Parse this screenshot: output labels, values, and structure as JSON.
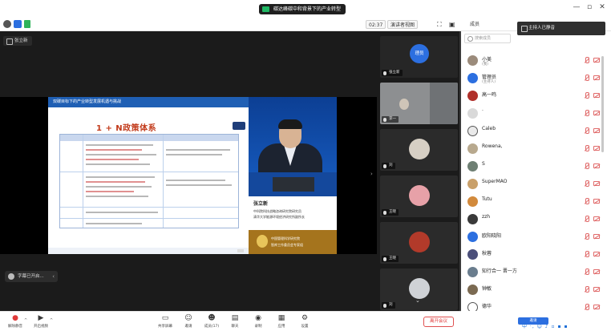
{
  "titlebar": {
    "meeting_title": "碳达峰碳中和背景下的产业转型",
    "min": "—",
    "max": "▫",
    "close": "✕"
  },
  "toolbar_row": {
    "timer": "02:37",
    "gallery_label": "演讲者视图",
    "members_label": "成员"
  },
  "stage": {
    "sharer_label": "张立新",
    "slide": {
      "header": "双碳目标下的产业转型发展机遇与挑战",
      "title": "1 + N政策体系"
    },
    "speaker": {
      "name": "张立新",
      "title_line1": "中科院科技战略咨询研究院研究员",
      "title_line2": "清华大学能源环境经济研究所副所长",
      "org_line1": "中国管理科学研究院",
      "org_line2": "智库工作委员会专家组"
    },
    "subtitle_chip": "字幕已开启..."
  },
  "video_strip": {
    "tiles": [
      {
        "label": "张立新",
        "kind": "avatar",
        "avatar_text": "理员"
      },
      {
        "label": "李一",
        "kind": "camera"
      },
      {
        "label": "刘",
        "kind": "photo"
      },
      {
        "label": "王晓",
        "kind": "photo"
      },
      {
        "label": "王晓",
        "kind": "photo"
      },
      {
        "label": "刘",
        "kind": "photo"
      }
    ]
  },
  "panel": {
    "search_placeholder": "搜索成员",
    "tip": "主持人已静音",
    "participants": [
      {
        "name": "小美",
        "sub": "(我)"
      },
      {
        "name": "管理员",
        "sub": "(主持人)"
      },
      {
        "name": "高一鸣",
        "sub": ""
      },
      {
        "name": "·",
        "sub": ""
      },
      {
        "name": "Caleb",
        "sub": ""
      },
      {
        "name": "Rowena,",
        "sub": ""
      },
      {
        "name": "S",
        "sub": ""
      },
      {
        "name": "SuperMAO",
        "sub": ""
      },
      {
        "name": "Tutu",
        "sub": ""
      },
      {
        "name": "zzh",
        "sub": ""
      },
      {
        "name": "欧阳晓阳",
        "sub": ""
      },
      {
        "name": "秋蓉",
        "sub": ""
      },
      {
        "name": "知行合一 晋一方",
        "sub": ""
      },
      {
        "name": "钟敏",
        "sub": ""
      },
      {
        "name": "德华",
        "sub": ""
      }
    ],
    "invite_label": "邀请",
    "tray": "中 ·, ☺ ♪ ▫ ▪ ▪"
  },
  "bottom_toolbar": {
    "items": [
      {
        "glyph": "🎤",
        "label": "解除静音"
      },
      {
        "glyph": "▶",
        "label": "开启视频"
      },
      {
        "glyph": "▭",
        "label": "共享屏幕"
      },
      {
        "glyph": "☺",
        "label": "邀请"
      },
      {
        "glyph": "☻",
        "label": "成员(17)"
      },
      {
        "glyph": "▤",
        "label": "聊天"
      },
      {
        "glyph": "◉",
        "label": "录制"
      },
      {
        "glyph": "▦",
        "label": "应用"
      },
      {
        "glyph": "⚙",
        "label": "设置"
      }
    ],
    "leave_label": "离开会议"
  },
  "colors": {
    "stage_bg": "#1b1b1b",
    "accent": "#2c6fe0",
    "danger": "#e03a3a",
    "slide_header": "#1f5fb4",
    "slide_title": "#c23a1a"
  }
}
